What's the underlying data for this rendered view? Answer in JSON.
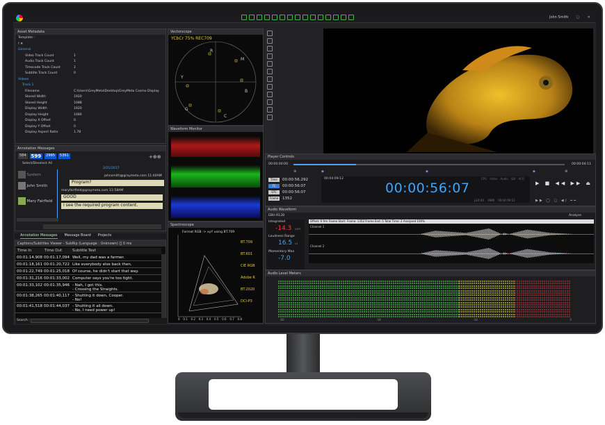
{
  "topbar": {
    "user": "John Smith"
  },
  "asset_metadata": {
    "title": "Asset Metadata",
    "template_label": "Template :",
    "groups": [
      {
        "label": "General",
        "rows": [
          [
            "Video Track Count",
            "1"
          ],
          [
            "Audio Track Count",
            "1"
          ],
          [
            "Timecode Track Count",
            "2"
          ],
          [
            "Subtitle Track Count",
            "0"
          ]
        ]
      },
      {
        "label": "Videos",
        "sub": "Track 1",
        "rows": [
          [
            "Filename",
            "C:\\Users\\GreyMeta\\Desktop\\GreyMeta Cosmo Display"
          ],
          [
            "Stored Width",
            "1920"
          ],
          [
            "Stored Height",
            "1088"
          ],
          [
            "Display Width",
            "1920"
          ],
          [
            "Display Height",
            "1080"
          ],
          [
            "Display X Offset",
            "0"
          ],
          [
            "Display Y Offset",
            "0"
          ],
          [
            "Display Aspect Ratio",
            "1.78"
          ]
        ]
      }
    ]
  },
  "annotations": {
    "title": "Annotation Messages",
    "counts": [
      "584",
      "599",
      "2995",
      "5391"
    ],
    "select_all": "Select/Deselect All",
    "date": "2/21/2017",
    "items": [
      {
        "user": "System",
        "email": "johnsmith@graymeta.com",
        "time": "11:40AM",
        "text": "Program?"
      },
      {
        "user": "John Smith",
        "email": "maryfairfield@graymeta.com",
        "time": "11:58AM",
        "text": "GOOD"
      },
      {
        "user": "Mary Fairfield",
        "email": "",
        "time": "",
        "text": "I see the required program content."
      }
    ],
    "tabs": [
      "Annotation Messages",
      "Message Board",
      "Projects"
    ]
  },
  "subtitles": {
    "title": "Captions/Subtitles Viewer - SubRip (Language : Unknown) [] 0 ms",
    "headers": [
      "Time In",
      "Time Out",
      "Subtitle Text"
    ],
    "rows": [
      [
        "00:01:14,908",
        "00:01:17,094",
        "Well, my dad was a farmer."
      ],
      [
        "00:01:18,161",
        "00:01:20,722",
        "Like everybody else back then."
      ],
      [
        "00:01:22,749",
        "00:01:25,018",
        "Of course, he didn't start that way."
      ],
      [
        "00:01:31,216",
        "00:01:33,002",
        "Computer says you're too tight."
      ],
      [
        "00:01:33,102",
        "00:01:35,946",
        "- Nah, I got this.\n- Crossing the Straights."
      ],
      [
        "00:01:38,265",
        "00:01:40,117",
        "- Shutting it down, Cooper.\n- No!"
      ],
      [
        "00:01:41,518",
        "00:01:44,037",
        "- Shutting it all down.\n- No, I need power up!"
      ]
    ],
    "search_label": "Search :"
  },
  "vectorscope": {
    "title": "Vectorscope",
    "label": "YCbCr 75% REC709",
    "targets": [
      "R",
      "M",
      "Y",
      "B",
      "G",
      "C"
    ]
  },
  "waveform": {
    "title": "Waveform Monitor"
  },
  "spectroscope": {
    "title": "Spectroscope",
    "format": "Format RGB -> xyY using BT.709",
    "spaces": [
      "BT.709",
      "BT.601",
      "CIE RGB",
      "Adobe R",
      "BT.2020",
      "DCI-P3"
    ],
    "ticks": [
      "0",
      "0.1",
      "0.2",
      "0.3",
      "0.4",
      "0.5",
      "0.6",
      "0.7",
      "0.8"
    ]
  },
  "player": {
    "title": "Player Controls",
    "start": "00:00:00:00",
    "end": "00:00:04:11",
    "rows": [
      [
        "Time",
        "00:00:56.292"
      ],
      [
        "TC",
        "00:00:56:07"
      ],
      [
        "STC",
        "00:00:56:07"
      ],
      [
        "Frame",
        "1352"
      ]
    ],
    "big_tc": "00:00:56:07",
    "small_tc": "00:04:09:12",
    "status": [
      "CPU",
      "Video",
      "Audio",
      "SDI",
      "AFD"
    ],
    "foot": [
      "p24.00",
      "3986",
      "00:04:09:12"
    ]
  },
  "audio_waveform": {
    "title": "Audio Waveform",
    "tab": "EBU-R128",
    "analyse": "Analyse",
    "info": "Offset: 0 frm Frame Start: Frame: 1352 Frame End: 5 Total Time: 2 Analysed 100%",
    "integrated_label": "Integrated",
    "integrated": "-14.3",
    "lu": "LUFS",
    "range_label": "Loudness Range",
    "range": "16.5",
    "range_unit": "LU",
    "momentary_label": "Momentary Max",
    "momentary": "-7.0",
    "channels": [
      "Channel 1",
      "Channel 2"
    ]
  },
  "level_meters": {
    "title": "Audio Level Meters",
    "scale": [
      "-60",
      "-18",
      "-18",
      "0",
      "0"
    ]
  }
}
